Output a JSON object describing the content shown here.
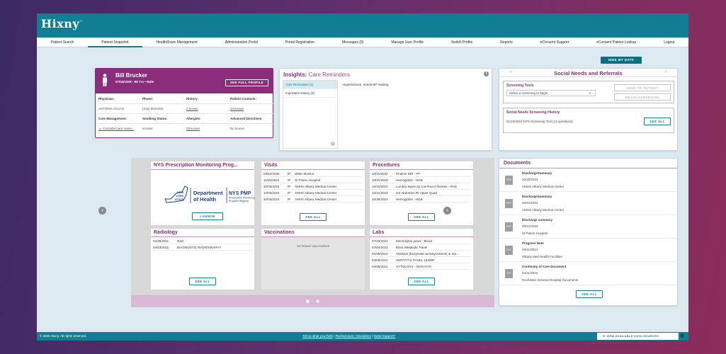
{
  "brand": {
    "name": "Hixny",
    "mark": "™"
  },
  "nav": [
    "Patient Search",
    "Patient Snapshot",
    "HealthShare Management",
    "Administration Portal",
    "Portal Registration",
    "Messages (0)",
    "Manage User Profile",
    "Switch Profile",
    "Reports",
    "eConsent Support",
    "eConsent Patient Lookup",
    "Logout"
  ],
  "hide_btn": "HIDE MY DATA",
  "patient": {
    "name": "Bill Brucker",
    "meta": "07/04/1928  •  96 Yrs  •  Male",
    "full_profile": "SEE FULL PROFILE",
    "labels1": [
      "Physician:",
      "Phone:",
      "History:",
      "Patient Contacts:"
    ],
    "values1": [
      "ANTONIA SOJAN",
      "(315) 8634250",
      "2 known",
      "13 known"
    ],
    "labels2": [
      "Care Management:",
      "Smoking Status:",
      "Allergies:",
      "Advanced Directives:"
    ],
    "values2": [
      "Consider care mana...",
      "smoker",
      "28 known",
      "No known"
    ]
  },
  "insights": {
    "title": "Insights:",
    "subtitle": "Care Reminders",
    "tabs": [
      "Care Reminders (1)",
      "Important History (3)"
    ],
    "detail": "Hypertensive, needs BP reading"
  },
  "social": {
    "title": "Social Needs and Referrals",
    "prev": "‹",
    "next": "›",
    "tools_title": "Screening Tools",
    "select_placeholder": "Select a screening to begin",
    "send_btn": "SEND TO PATIENT",
    "begin_btn": "BEGIN SCREENING",
    "history_title": "Social Needs Screening History",
    "history_row": "01/24/2023   NYS Screening Tool (12 questions)",
    "see_all": "SEE ALL"
  },
  "pmp": {
    "title": "NYS Prescription Monitoring Prog...",
    "logo_state": "NEW YORK STATE",
    "logo_dept": "Department of Health",
    "logo_pmp": "NYS PMP",
    "logo_sub1": "Prescription Monitoring",
    "logo_sub2": "Program Registry",
    "launch": "LAUNCH"
  },
  "visits": {
    "title": "Visits",
    "rows": [
      {
        "d": "03/22/2025",
        "t": "IP",
        "n": "WMC Monitor"
      },
      {
        "d": "11/26/2024",
        "t": "IP",
        "n": "St Peters Hospital"
      },
      {
        "d": "10/03/2024",
        "t": "IP",
        "n": "AMHS Albany Medical Center"
      },
      {
        "d": "10/03/2024",
        "t": "IP",
        "n": "AMHS Albany Medical Center"
      },
      {
        "d": "10/03/2024",
        "t": "IP",
        "n": "AMHS Albany Medical Center"
      }
    ],
    "see_all": "SEE ALL"
  },
  "procedures": {
    "title": "Procedures",
    "rows": [
      {
        "d": "10/31/2024",
        "n": "Protime INR - PT"
      },
      {
        "d": "10/31/2024",
        "n": "Hemoglobin - HGB"
      },
      {
        "d": "10/31/2024",
        "n": "Lumbar Spine Ap Lat Rout 2-3Views - RAD"
      },
      {
        "d": "10/31/2024",
        "n": "US Abdomen Rt Upper Quad"
      },
      {
        "d": "10/30/2024",
        "n": "Hemoglobin - HGB"
      }
    ],
    "see_all": "SEE ALL"
  },
  "radiology": {
    "title": "Radiology",
    "rows": [
      {
        "d": "04/26/2011",
        "n": "RAD"
      },
      {
        "d": "04/23/2011",
        "n": "DIAGNOSTIC RADIOGRAPHY"
      }
    ],
    "see_all": "SEE ALL"
  },
  "vaccinations": {
    "title": "Vaccinations",
    "empty": "No known vaccinations"
  },
  "labs": {
    "title": "Labs",
    "rows": [
      {
        "d": "07/20/2023",
        "n": "Electrolytes panel - Blood"
      },
      {
        "d": "07/04/2023",
        "n": "Basic Metabolic Panel"
      },
      {
        "d": "01/09/2014",
        "n": "Aldolase [Enzymatic activity/volume] in Ser..."
      },
      {
        "d": "04/06/2012",
        "n": "HEPATITIS PANEL 10306F"
      },
      {
        "d": "04/06/2012",
        "n": "CYTOLOGY - NON GYN"
      }
    ],
    "see_all": "SEE ALL"
  },
  "carousel": {
    "prev": "‹",
    "next": "›"
  },
  "documents": {
    "title": "Documents",
    "items": [
      {
        "icon": "PDF",
        "name": "DischargeSummary",
        "date": "10/30/2024",
        "src": "AMHS Albany Medical Center"
      },
      {
        "icon": "PDF",
        "name": "DischargeSummary",
        "date": "10/31/2024",
        "src": "AMHS Albany Medical Center"
      },
      {
        "icon": "PDF",
        "name": "Discharge summary",
        "date": "09/12/2024",
        "src": "St Peters Hospital"
      },
      {
        "icon": "PDF",
        "name": "Progress Note",
        "date": "09/11/2024",
        "src": "Albany Med Health Facilities"
      },
      {
        "icon": "TXT",
        "name": "Continuity of Care Document",
        "date": "04/11/2024",
        "src": "Rochester General Hospital Documents"
      }
    ],
    "see_all": "SEE ALL"
  },
  "footer": {
    "copyright": "© 2025 Hixny. All rights reserved.",
    "link1": "Tell us what you think",
    "sep": " | ",
    "link2": "Redisclosure / Disclaimer",
    "link3": "Need Support?",
    "ds_btn": "VIEW AVAILABLE DATA SOURCES"
  },
  "colors": {
    "teal": "#107f94",
    "plum": "#8a2d7a",
    "warning": "#e3a008"
  }
}
